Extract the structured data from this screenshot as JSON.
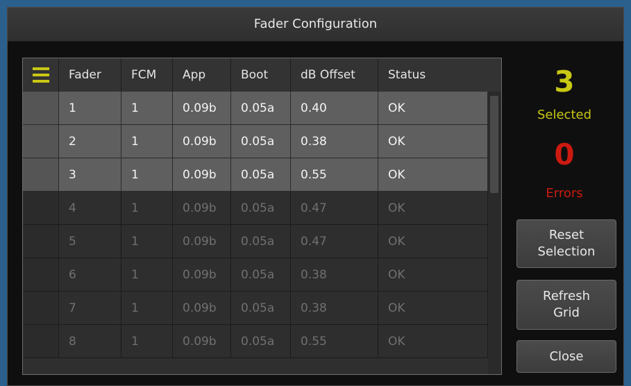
{
  "window": {
    "title": "Fader Configuration"
  },
  "grid": {
    "columns": [
      "Fader",
      "FCM",
      "App",
      "Boot",
      "dB Offset",
      "Status"
    ],
    "rows": [
      {
        "fader": "1",
        "fcm": "1",
        "app": "0.09b",
        "boot": "0.05a",
        "offset": "0.40",
        "status": "OK",
        "selected": true
      },
      {
        "fader": "2",
        "fcm": "1",
        "app": "0.09b",
        "boot": "0.05a",
        "offset": "0.38",
        "status": "OK",
        "selected": true
      },
      {
        "fader": "3",
        "fcm": "1",
        "app": "0.09b",
        "boot": "0.05a",
        "offset": "0.55",
        "status": "OK",
        "selected": true
      },
      {
        "fader": "4",
        "fcm": "1",
        "app": "0.09b",
        "boot": "0.05a",
        "offset": "0.47",
        "status": "OK",
        "selected": false
      },
      {
        "fader": "5",
        "fcm": "1",
        "app": "0.09b",
        "boot": "0.05a",
        "offset": "0.47",
        "status": "OK",
        "selected": false
      },
      {
        "fader": "6",
        "fcm": "1",
        "app": "0.09b",
        "boot": "0.05a",
        "offset": "0.38",
        "status": "OK",
        "selected": false
      },
      {
        "fader": "7",
        "fcm": "1",
        "app": "0.09b",
        "boot": "0.05a",
        "offset": "0.38",
        "status": "OK",
        "selected": false
      },
      {
        "fader": "8",
        "fcm": "1",
        "app": "0.09b",
        "boot": "0.05a",
        "offset": "0.55",
        "status": "OK",
        "selected": false
      }
    ]
  },
  "summary": {
    "selected_count": "3",
    "selected_label": "Selected",
    "errors_count": "0",
    "errors_label": "Errors",
    "selected_color": "#c9c814",
    "errors_color": "#cc1a10"
  },
  "buttons": {
    "reset": [
      "Reset",
      "Selection"
    ],
    "refresh": [
      "Refresh",
      "Grid"
    ],
    "close": "Close"
  }
}
